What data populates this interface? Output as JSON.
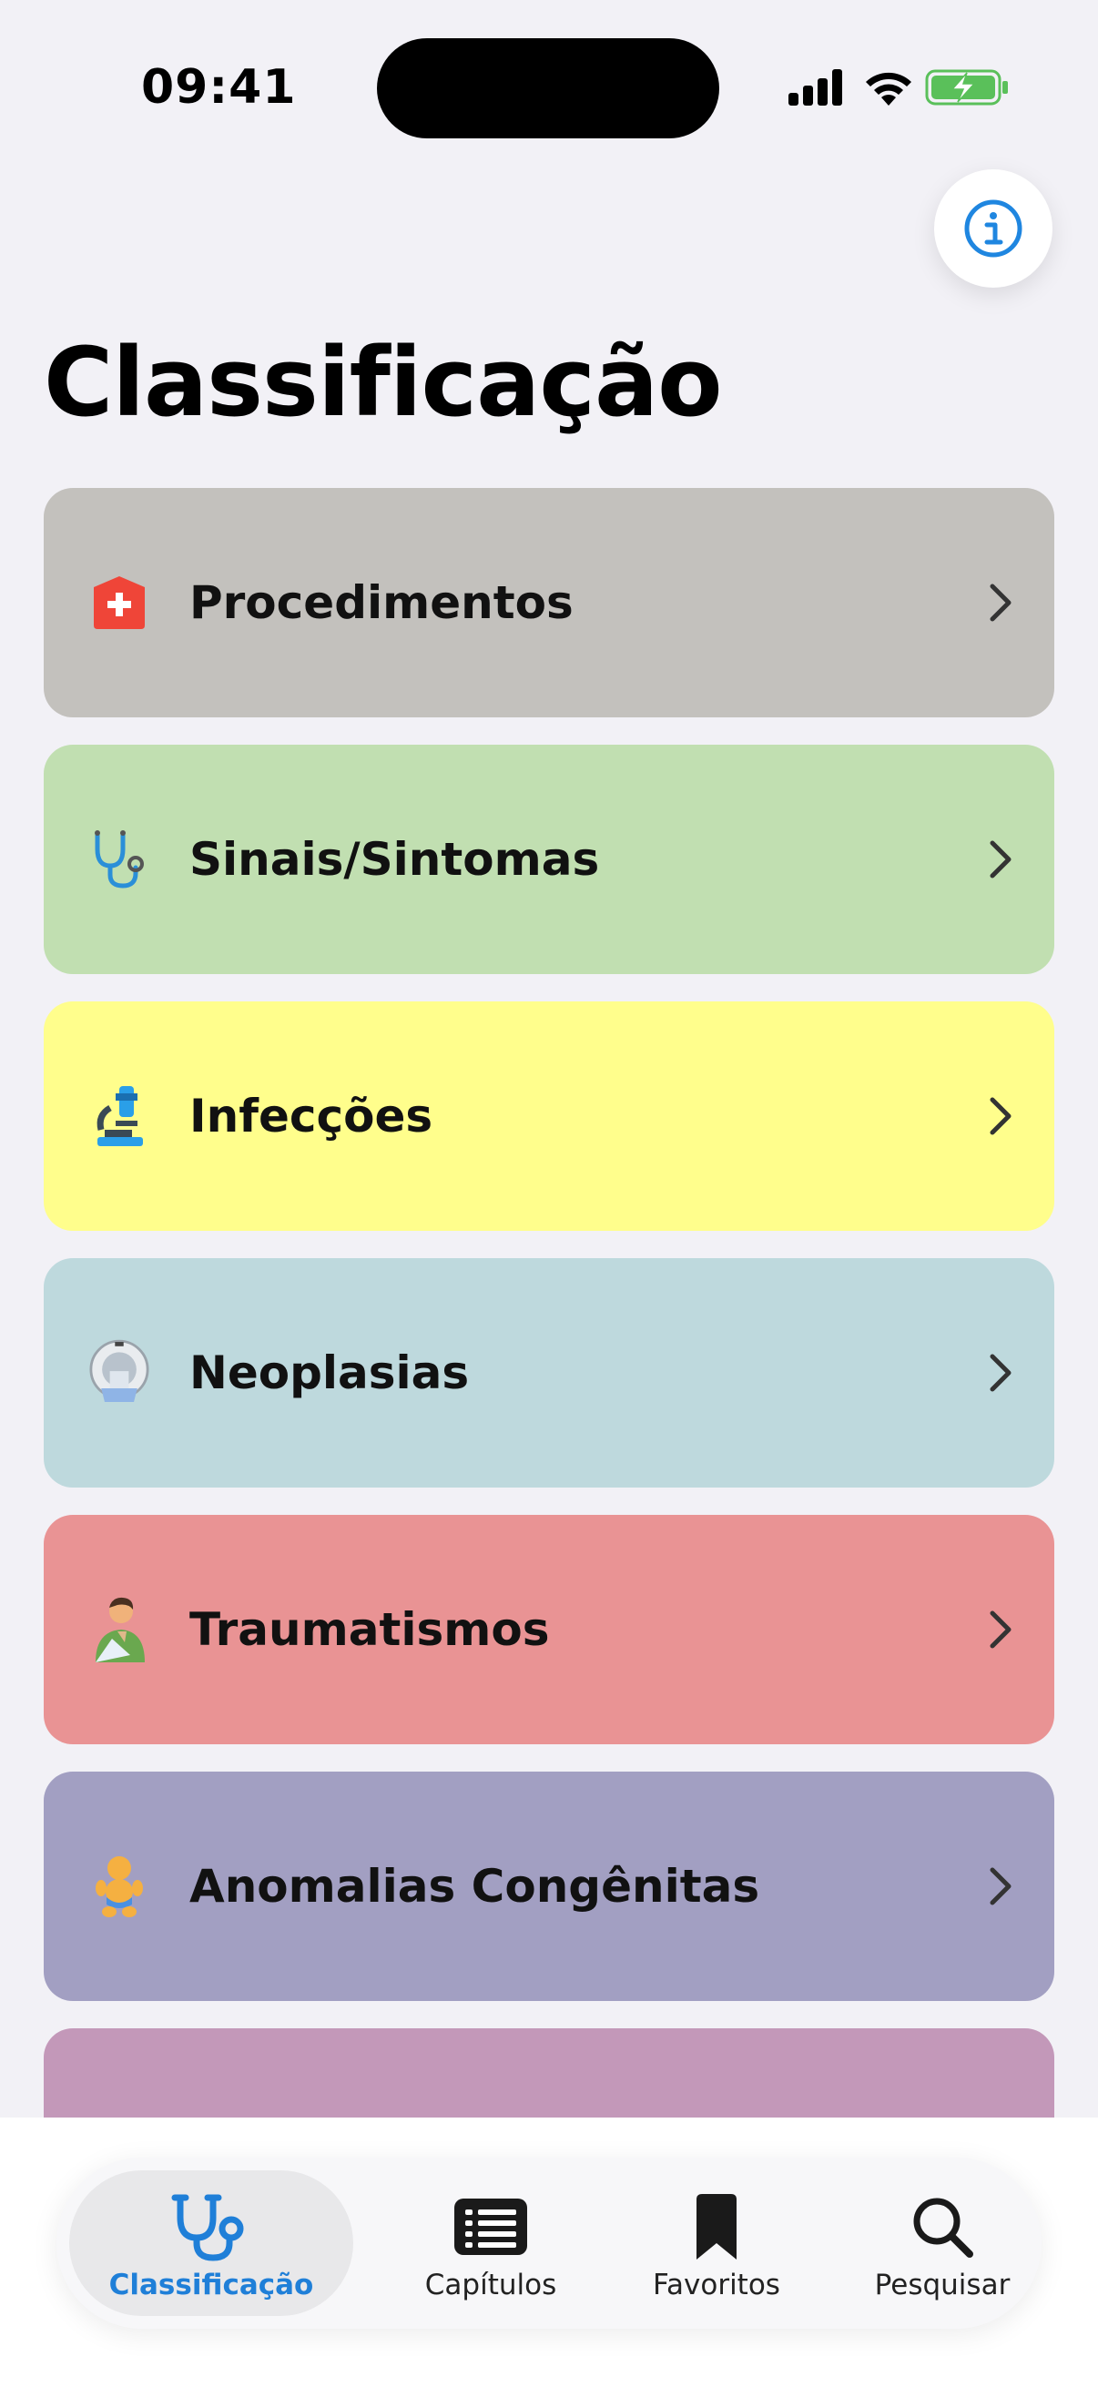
{
  "status_bar": {
    "time": "09:41"
  },
  "header": {
    "title": "Classificação",
    "info_icon": "info-circle-icon"
  },
  "categories": [
    {
      "label": "Procedimentos",
      "icon": "hospital-icon",
      "color": "#c3c1bd"
    },
    {
      "label": "Sinais/Sintomas",
      "icon": "stethoscope-icon",
      "color": "#c1dfb1"
    },
    {
      "label": "Infecções",
      "icon": "microscope-icon",
      "color": "#fffe8c"
    },
    {
      "label": "Neoplasias",
      "icon": "mri-scanner-icon",
      "color": "#bed9dd"
    },
    {
      "label": "Traumatismos",
      "icon": "person-arm-sling-icon",
      "color": "#e99394"
    },
    {
      "label": "Anomalias Congênitas",
      "icon": "baby-icon",
      "color": "#a29fc2"
    },
    {
      "label": "",
      "icon": "partial-icon",
      "color": "#c398b9"
    }
  ],
  "tabs": [
    {
      "label": "Classificação",
      "icon": "stethoscope-icon",
      "active": true
    },
    {
      "label": "Capítulos",
      "icon": "list-icon",
      "active": false
    },
    {
      "label": "Favoritos",
      "icon": "bookmark-icon",
      "active": false
    },
    {
      "label": "Pesquisar",
      "icon": "search-icon",
      "active": false
    }
  ],
  "colors": {
    "accent": "#1f7fd8",
    "background": "#f2f1f6"
  }
}
